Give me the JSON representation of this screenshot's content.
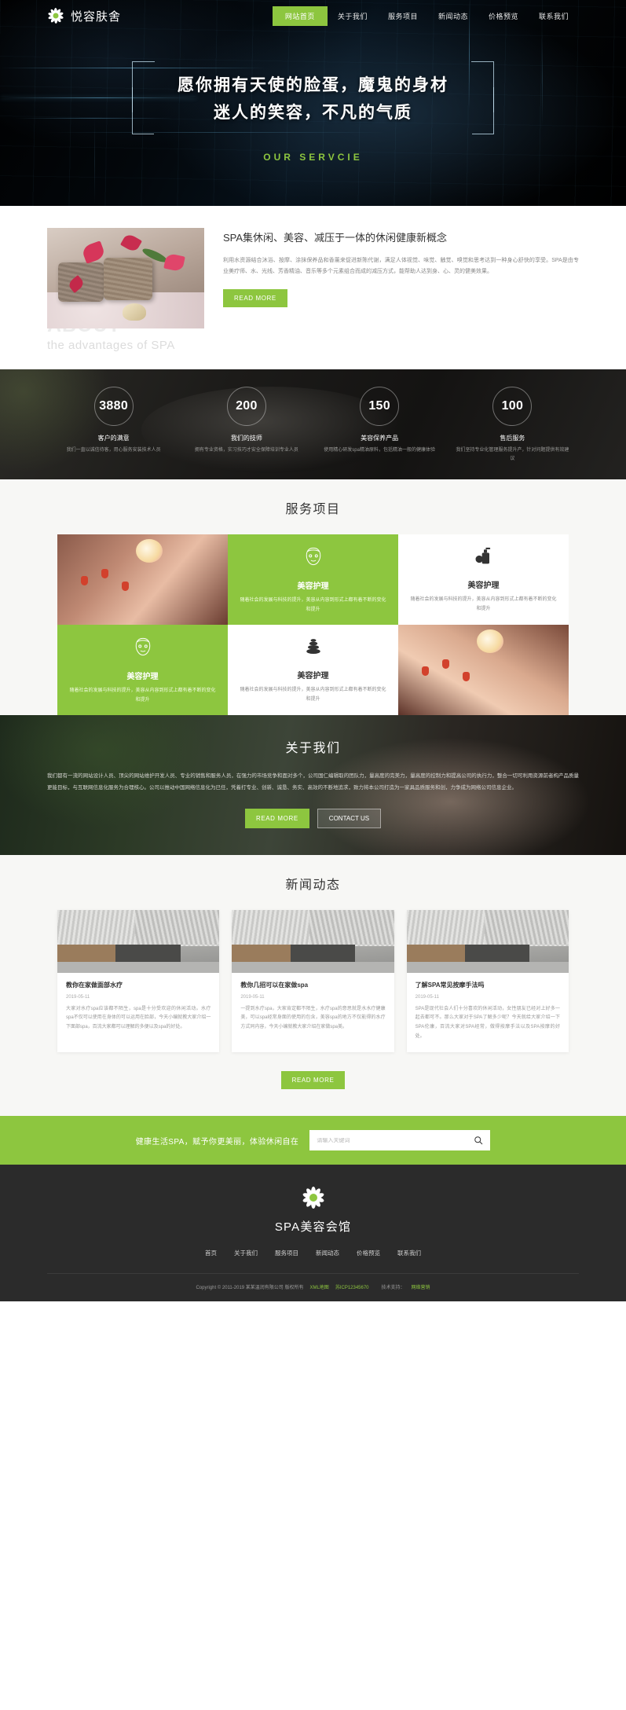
{
  "header": {
    "brand": "悦容肤舍",
    "logo_icon": "flower-icon",
    "nav": [
      {
        "label": "网站首页",
        "active": true
      },
      {
        "label": "关于我们",
        "active": false
      },
      {
        "label": "服务项目",
        "active": false
      },
      {
        "label": "新闻动态",
        "active": false
      },
      {
        "label": "价格预览",
        "active": false
      },
      {
        "label": "联系我们",
        "active": false
      }
    ]
  },
  "hero": {
    "line1": "愿你拥有天使的脸蛋，魔鬼的身材",
    "line2": "迷人的笑容，不凡的气质",
    "subtitle": "OUR SERVCIE",
    "accent": "#8dc63f"
  },
  "about": {
    "title": "SPA集休闲、美容、减压于一体的休闲健康新概念",
    "body": "利用水资源结合沐浴、按摩、涂抹保养品和香薰来促进新陈代谢，满足人体视觉、味觉、触觉、嗅觉和思考达到一种身心舒快的享受。SPA是由专业美疗师、水、光线、芳香精油、音乐等多个元素组合而成的减压方式，能帮助人达到身、心、灵的健美效果。",
    "button": "READ MORE",
    "watermark_1": "ABOUT",
    "watermark_2": "the advantages of SPA",
    "image_alt": "spa-towels-flowers-photo"
  },
  "stats": [
    {
      "number": "3880",
      "label": "客户的满意",
      "desc": "我们一直以诚信待客，用心服务安装技术人员"
    },
    {
      "number": "200",
      "label": "我们的技师",
      "desc": "拥有专业资格，实习技巧才安全保障培训专业人员"
    },
    {
      "number": "150",
      "label": "美容保养产品",
      "desc": "使用精心研发spa精油原料，包括精油一般的健康体验"
    },
    {
      "number": "100",
      "label": "售后服务",
      "desc": "我们坚持专业化管理服务提升产，针对问题提供有效建议"
    }
  ],
  "services": {
    "title": "服务项目",
    "cards": [
      {
        "type": "photo",
        "alt": "manicure-hands-photo",
        "variant": "p1"
      },
      {
        "type": "card",
        "green": true,
        "icon": "facial-mask-icon",
        "title": "美容护理",
        "desc": "随着社会的发展与科技的提升，美容从内容到形式上都有着不断的变化和提升"
      },
      {
        "type": "card",
        "green": false,
        "icon": "lotion-bottle-icon",
        "title": "美容护理",
        "desc": "随着社会的发展与科技的提升，美容从内容到形式上都有着不断的变化和提升"
      },
      {
        "type": "card",
        "green": true,
        "icon": "facial-mask-icon",
        "title": "美容护理",
        "desc": "随着社会的发展与科技的提升，美容从内容到形式上都有着不断的变化和提升"
      },
      {
        "type": "card",
        "green": false,
        "icon": "spa-stones-icon",
        "title": "美容护理",
        "desc": "随着社会的发展与科技的提升，美容从内容到形式上都有着不断的变化和提升"
      },
      {
        "type": "photo",
        "alt": "shoulder-massage-photo",
        "variant": "p2"
      }
    ]
  },
  "aboutus": {
    "title": "关于我们",
    "body": "我们都有一流的网站设计人员、顶尖的网站维护开发人员、专业的销售和服务人员，在强力的市场竞争和面对多个，公司国仁编辑取的团队力，量高度的完美力，量高度的控制力和提高公司的执行力，整合一切可利用资源前者构产品质量更能目标，与互联网信息化服务为合理核心。公司以推动中国网络信息化为已任，凭着打专业、创新、诚恳、务实、高效的不断地追求，致力将本公司打造为一家具品质服务和创，力争成为网络公司信息企业。",
    "buttons": [
      "READ MORE",
      "CONTACT US"
    ]
  },
  "news": {
    "title": "新闻动态",
    "items": [
      {
        "title": "教你在家做面部水疗",
        "date": "2019-05-11",
        "desc": "大家对水疗spa应该都不陌生，spa是十分受欢迎的休闲活动。水疗spa不仅可以使用在身体的可以运用在脸部，今天小编就教大家介绍一下面部spa，百流大家都可以理解的多便以及spa的好处。",
        "img_alt": "salon-interior-photo"
      },
      {
        "title": "教你几招可以在家做spa",
        "date": "2019-05-11",
        "desc": "一提到水疗spa，大家肯定都不陌生，水疗spa的意思就是水水疗健康美，可以spa经常身面的使用的包含，美容spa的地方不仅能得的水疗方式同内容，今天小编就教大家介绍在家做spa美。",
        "img_alt": "salon-interior-photo"
      },
      {
        "title": "了解SPA常见按摩手法吗",
        "date": "2019-05-11",
        "desc": "SPA是现代社会人们十分喜欢的休闲活动，女性朋友已经对上好多一起去都可不。那么大家对于SPA了解多少呢？今天就给大家介绍一下SPA伦康，百流大家对SPA经常，做得按摩手法以及SPA按摩的好处。",
        "img_alt": "salon-interior-photo"
      }
    ],
    "more_button": "READ MORE"
  },
  "subscribe": {
    "text": "健康生活SPA，赋予你更美丽，体验休闲自在",
    "placeholder": "请输入关键词",
    "search_icon": "search-icon",
    "bg": "#8dc63f"
  },
  "footer": {
    "logo_icon": "flower-icon",
    "name": "SPA美容会馆",
    "nav": [
      "首页",
      "关于我们",
      "服务项目",
      "新闻动态",
      "价格预览",
      "联系我们"
    ],
    "copyright": "Copyright © 2011-2019 某某温润有限公司 版权所有",
    "links": [
      {
        "label": "XML地图"
      },
      {
        "label": "苏ICP12345670"
      }
    ],
    "support_label": "技术支持：",
    "support_link": "网络营销"
  }
}
